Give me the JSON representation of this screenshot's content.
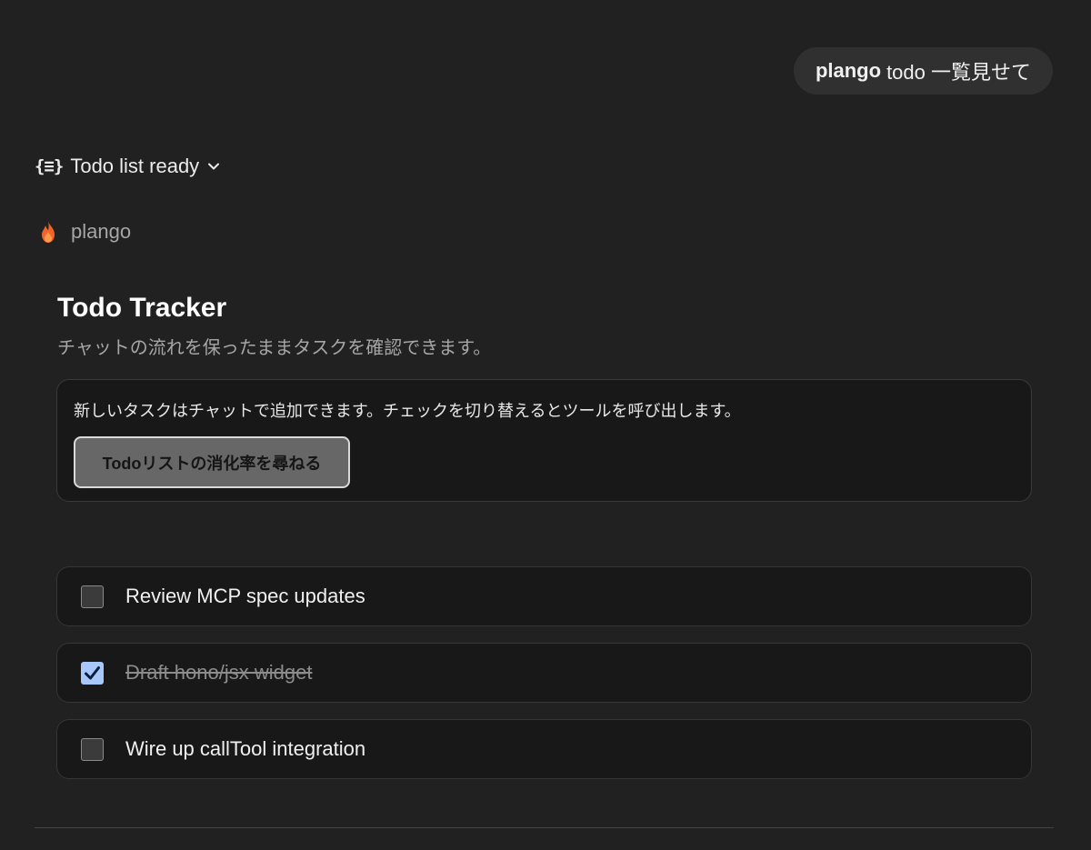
{
  "user_message": {
    "bold": "plango",
    "text": "todo 一覧見せて"
  },
  "tool_status": {
    "icon": "braces-list-icon",
    "label": "Todo list ready",
    "toggle_icon": "chevron-down-icon"
  },
  "app": {
    "icon": "flame-icon",
    "name": "plango"
  },
  "widget": {
    "title": "Todo Tracker",
    "subtitle": "チャットの流れを保ったままタスクを確認できます。",
    "info_text": "新しいタスクはチャットで追加できます。チェックを切り替えるとツールを呼び出します。",
    "ask_button_label": "Todoリストの消化率を尋ねる",
    "todos": [
      {
        "label": "Review MCP spec updates",
        "done": false
      },
      {
        "label": "Draft hono/jsx widget",
        "done": true
      },
      {
        "label": "Wire up callTool integration",
        "done": false
      }
    ]
  },
  "colors": {
    "background": "#212121",
    "card": "#181818",
    "checked": "#a8c7fa",
    "flame": "#f0642a"
  }
}
